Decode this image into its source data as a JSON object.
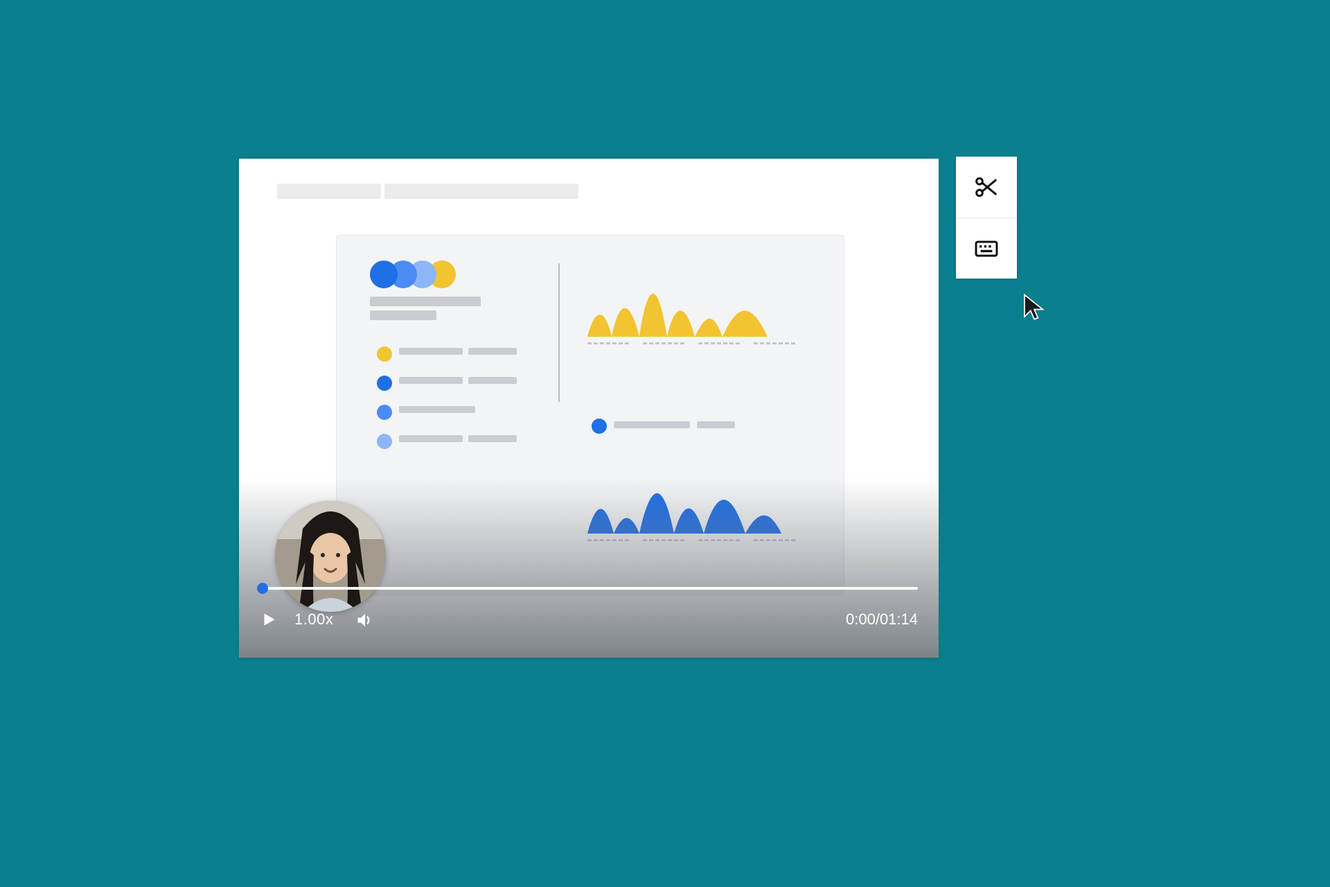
{
  "player": {
    "playback_speed": "1.00x",
    "current_time": "0:00",
    "duration": "01:14",
    "time_separator": " / ",
    "progress": 0
  },
  "toolbar": {
    "items": [
      {
        "name": "trim",
        "icon": "scissors-icon"
      },
      {
        "name": "keyboard",
        "icon": "keyboard-icon"
      }
    ]
  },
  "colors": {
    "background": "#0a7f8e",
    "blue": "#1f6fe5",
    "yellow": "#f2c431"
  }
}
